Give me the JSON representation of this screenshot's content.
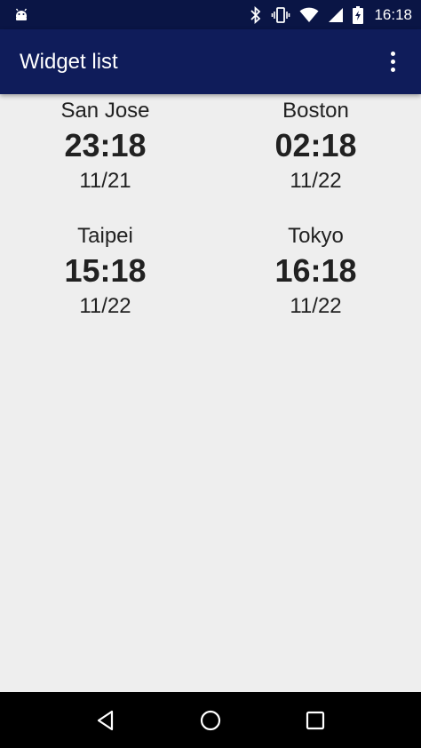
{
  "status_bar": {
    "time": "16:18",
    "icons": [
      "android-icon",
      "bluetooth-icon",
      "vibrate-icon",
      "wifi-icon",
      "cellular-signal-icon",
      "battery-charging-icon"
    ]
  },
  "app_bar": {
    "title": "Widget list",
    "overflow_icon": "more-vert-icon"
  },
  "clocks": [
    {
      "city": "San Jose",
      "time": "23:18",
      "date": "11/21"
    },
    {
      "city": "Boston",
      "time": "02:18",
      "date": "11/22"
    },
    {
      "city": "Taipei",
      "time": "15:18",
      "date": "11/22"
    },
    {
      "city": "Tokyo",
      "time": "16:18",
      "date": "11/22"
    }
  ],
  "nav_bar": {
    "icons": [
      "back-icon",
      "home-icon",
      "recents-icon"
    ]
  },
  "colors": {
    "status_bar": "#0a1545",
    "app_bar": "#0f1c5a",
    "background": "#eeeeee",
    "text": "#212121",
    "nav_bar": "#000000"
  }
}
